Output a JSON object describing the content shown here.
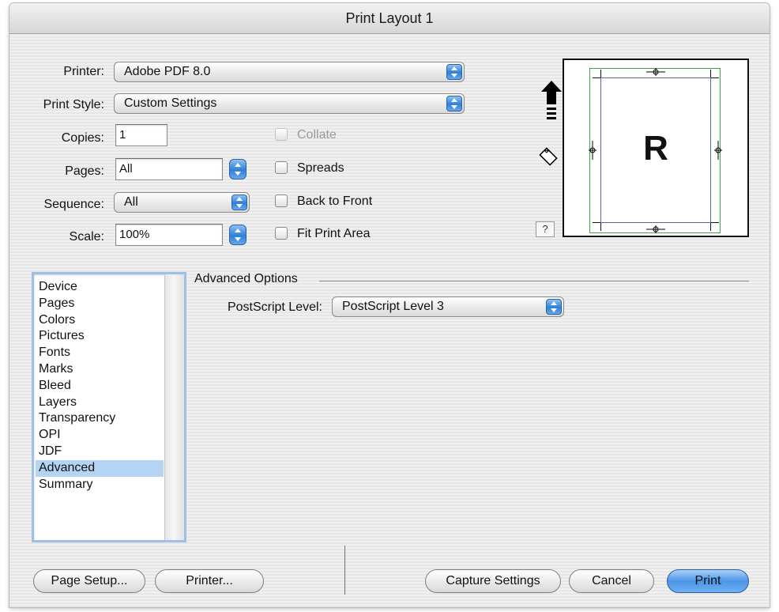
{
  "window": {
    "title": "Print Layout 1"
  },
  "form": {
    "printer": {
      "label": "Printer:",
      "value": "Adobe PDF 8.0"
    },
    "print_style": {
      "label": "Print Style:",
      "value": "Custom Settings"
    },
    "copies": {
      "label": "Copies:",
      "value": "1"
    },
    "pages": {
      "label": "Pages:",
      "value": "All"
    },
    "sequence": {
      "label": "Sequence:",
      "value": "All"
    },
    "scale": {
      "label": "Scale:",
      "value": "100%"
    }
  },
  "checkboxes": {
    "collate": {
      "label": "Collate",
      "checked": false,
      "enabled": false
    },
    "spreads": {
      "label": "Spreads",
      "checked": false,
      "enabled": true
    },
    "back_to_front": {
      "label": "Back to Front",
      "checked": false,
      "enabled": true
    },
    "fit_print_area": {
      "label": "Fit Print Area",
      "checked": false,
      "enabled": true
    }
  },
  "preview": {
    "page_letter": "R",
    "help_label": "?"
  },
  "categories": {
    "items": [
      "Device",
      "Pages",
      "Colors",
      "Pictures",
      "Fonts",
      "Marks",
      "Bleed",
      "Layers",
      "Transparency",
      "OPI",
      "JDF",
      "Advanced",
      "Summary"
    ],
    "selected": "Advanced"
  },
  "advanced": {
    "group_title": "Advanced Options",
    "postscript_level": {
      "label": "PostScript Level:",
      "value": "PostScript Level 3"
    }
  },
  "buttons": {
    "page_setup": "Page Setup...",
    "printer": "Printer...",
    "capture_settings": "Capture Settings",
    "cancel": "Cancel",
    "print": "Print"
  },
  "colors": {
    "accent": "#2f7fd9",
    "selection": "#b5d3f3",
    "sheet_margin": "#3aa845",
    "sheet_content": "#5b63a8"
  }
}
